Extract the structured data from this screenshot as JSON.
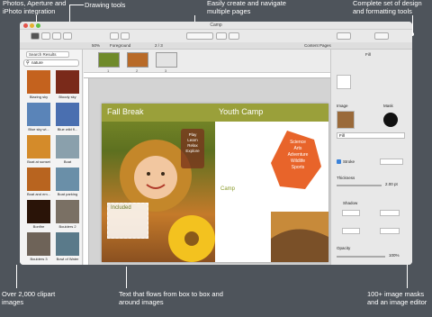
{
  "callouts": {
    "photos": "Photos, Aperture and iPhoto integration",
    "drawing": "Drawing tools",
    "pages": "Easily create and navigate multiple pages",
    "design": "Complete set of design and formatting tools",
    "clipart": "Over 2,000 clipart images",
    "textflow": "Text that flows from box to box and around images",
    "masks": "100+ image masks and an image editor"
  },
  "window": {
    "title": "Camp",
    "zoom": "50%",
    "layer": "Foreground",
    "page_counter": "2 / 3",
    "content_pages": "Content Pages"
  },
  "sidebar": {
    "source": "Search Results",
    "search_value": "nature",
    "items": [
      {
        "label": "Blazing sky",
        "color": "#c4621e"
      },
      {
        "label": "Bloody sky",
        "color": "#7a2a1a"
      },
      {
        "label": "Blue sky wi...",
        "color": "#5a84b8"
      },
      {
        "label": "Blue wild fl...",
        "color": "#4a6fb0"
      },
      {
        "label": "Boat at sunset",
        "color": "#d48b2a"
      },
      {
        "label": "Boat",
        "color": "#8aa0ac"
      },
      {
        "label": "Boat and em...",
        "color": "#b8641f"
      },
      {
        "label": "Boat parking",
        "color": "#6a8fa8"
      },
      {
        "label": "Bonfire",
        "color": "#2a1408"
      },
      {
        "label": "Boulders 2",
        "color": "#7a7064"
      },
      {
        "label": "Boulders 3",
        "color": "#6e6358"
      },
      {
        "label": "Bowl of Water",
        "color": "#5a7a8a"
      }
    ]
  },
  "pages": [
    {
      "num": "1",
      "color": "#6f8a2a"
    },
    {
      "num": "2",
      "color": "#b86a28"
    },
    {
      "num": "3",
      "color": "#e3e3e3"
    }
  ],
  "document": {
    "left_heading": "Fall Break",
    "right_heading": "Youth Camp",
    "play_words": [
      "Play",
      "Learn",
      "Relax",
      "Explore"
    ],
    "leaf_words": [
      "Science",
      "Arts",
      "Adventure",
      "Wildlife",
      "Sports"
    ],
    "camp_subhead": "Camp",
    "included": "Included"
  },
  "inspector": {
    "fill": "Fill",
    "image": "Image",
    "mask": "Mask",
    "fill_select": "Fill",
    "stroke": "Stroke",
    "thickness": "Thickness",
    "thickness_value": "2.00 pt",
    "shadow": "Shadow",
    "opacity": "Opacity",
    "opacity_value": "100%"
  },
  "colors": {
    "accent": "#3b82d9",
    "leaf": "#e8642a",
    "banner": "#9aa03a"
  }
}
